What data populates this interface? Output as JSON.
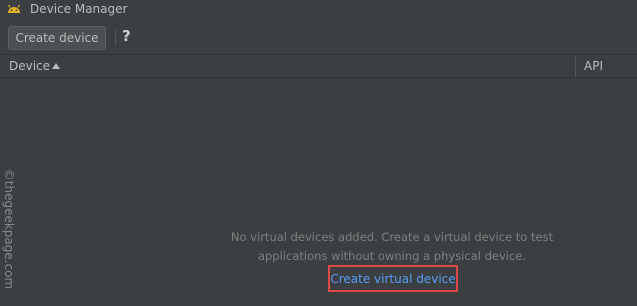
{
  "window": {
    "title": "Device Manager",
    "title_icon": "android-icon"
  },
  "toolbar": {
    "create_device_label": "Create device",
    "help_label": "?"
  },
  "table": {
    "columns": [
      {
        "label": "Device",
        "sort": "ascending"
      },
      {
        "label": "API"
      }
    ]
  },
  "empty_state": {
    "line1": "No virtual devices added. Create a virtual device to test",
    "line2": "applications without owning a physical device.",
    "link_label": "Create virtual device"
  },
  "watermark": "©thegeekpage.com",
  "colors": {
    "background": "#3c3f41",
    "link": "#589df6",
    "highlight_box": "#e04848",
    "android_green": "#f2c94c"
  }
}
